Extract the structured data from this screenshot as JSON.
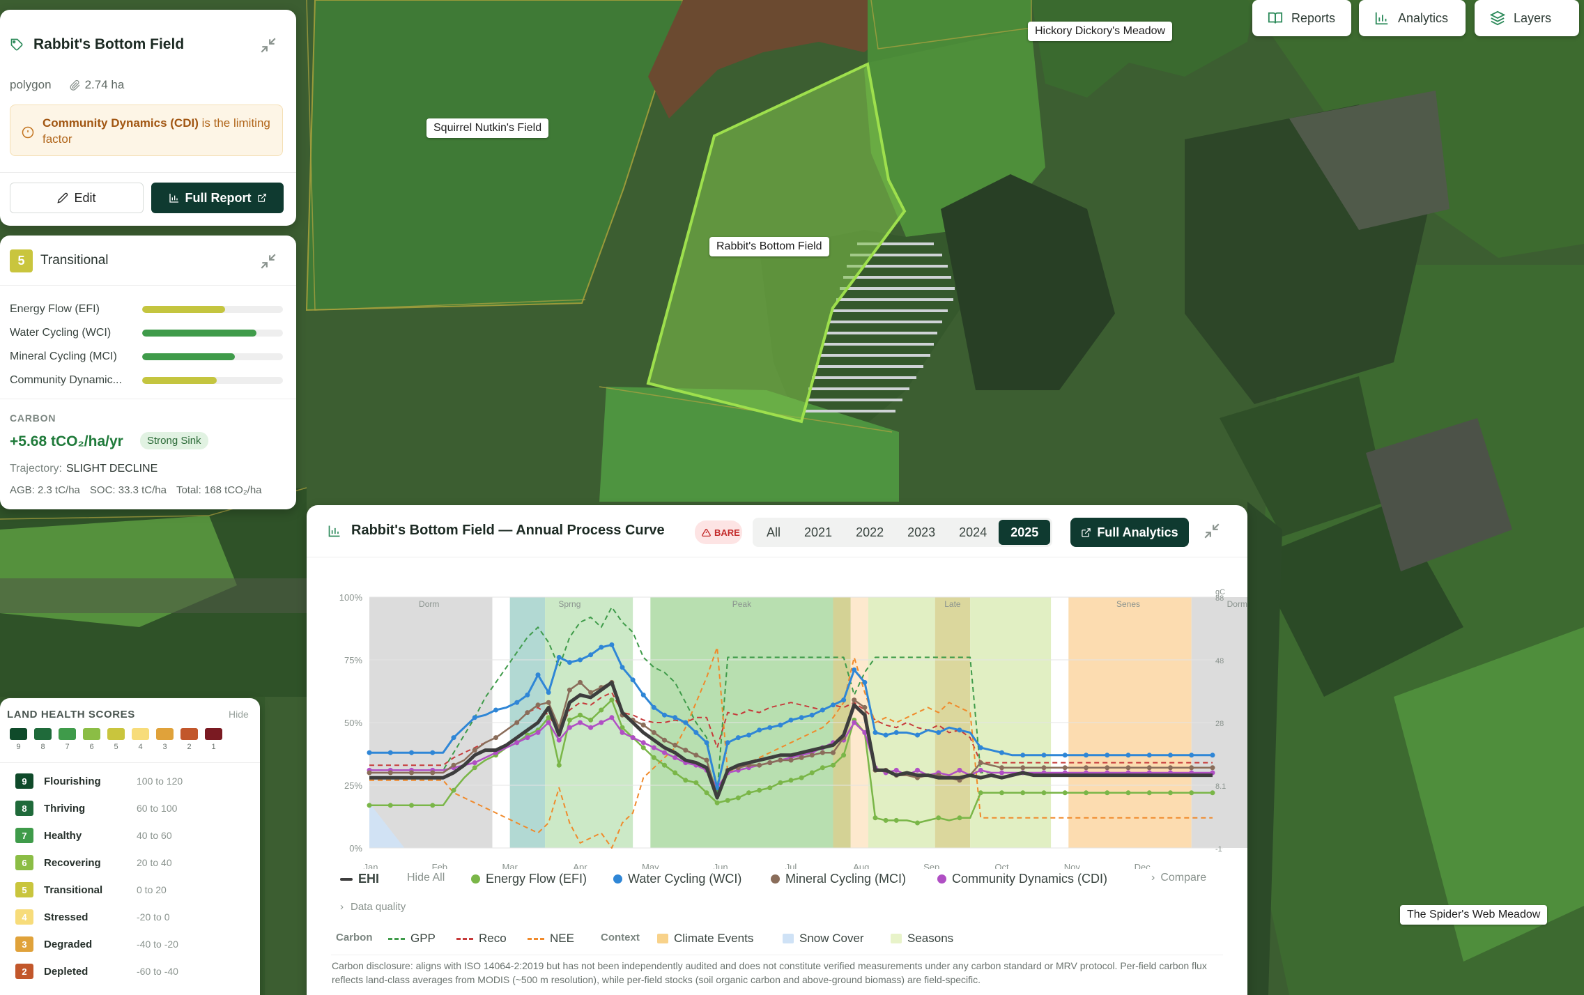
{
  "map": {
    "labels": {
      "squirrel": "Squirrel Nutkin's Field",
      "rabbit": "Rabbit's Bottom Field",
      "hickory": "Hickory Dickory's Meadow",
      "spider": "The Spider's Web Meadow"
    }
  },
  "toolbar": {
    "reports": "Reports",
    "analytics": "Analytics",
    "layers": "Layers"
  },
  "field_card": {
    "title": "Rabbit's Bottom Field",
    "geometry": "polygon",
    "area": "2.74 ha",
    "limiting_bold": "Community Dynamics (CDI)",
    "limiting_rest": " is the limiting factor",
    "edit_label": "Edit",
    "report_label": "Full Report"
  },
  "score_card": {
    "score": "5",
    "state": "Transitional",
    "state_color": "#c9c53d",
    "indices": [
      {
        "label": "Energy Flow (EFI)",
        "value": 0.59,
        "color": "#c4c53f"
      },
      {
        "label": "Water Cycling (WCI)",
        "value": 0.81,
        "color": "#3f9b4a"
      },
      {
        "label": "Mineral Cycling (MCI)",
        "value": 0.66,
        "color": "#3f9b4a"
      },
      {
        "label": "Community Dynamic...",
        "value": 0.53,
        "color": "#c4c53f"
      }
    ],
    "carbon_heading": "CARBON",
    "carbon_value": "+5.68 tCO₂/ha/yr",
    "sink_label": "Strong Sink",
    "trajectory_label": "Trajectory:",
    "trajectory_value": "SLIGHT DECLINE",
    "agb": "AGB: 2.3 tC/ha",
    "soc": "SOC: 33.3 tC/ha",
    "total": "Total: 168 tCO₂/ha"
  },
  "legend": {
    "title": "LAND HEALTH SCORES",
    "hide_label": "Hide",
    "swatches": [
      {
        "n": "9",
        "color": "#0f4a2a"
      },
      {
        "n": "8",
        "color": "#1f6a3a"
      },
      {
        "n": "7",
        "color": "#3f9b4a"
      },
      {
        "n": "6",
        "color": "#8bbd45"
      },
      {
        "n": "5",
        "color": "#c9c53d"
      },
      {
        "n": "4",
        "color": "#f7dc7a"
      },
      {
        "n": "3",
        "color": "#e0a23a"
      },
      {
        "n": "2",
        "color": "#c2572b"
      },
      {
        "n": "1",
        "color": "#7a1a22"
      }
    ],
    "rows": [
      {
        "n": "9",
        "name": "Flourishing",
        "range": "100 to 120",
        "color": "#0f4a2a"
      },
      {
        "n": "8",
        "name": "Thriving",
        "range": "60 to 100",
        "color": "#1f6a3a"
      },
      {
        "n": "7",
        "name": "Healthy",
        "range": "40 to 60",
        "color": "#3f9b4a"
      },
      {
        "n": "6",
        "name": "Recovering",
        "range": "20 to 40",
        "color": "#8bbd45"
      },
      {
        "n": "5",
        "name": "Transitional",
        "range": "0 to 20",
        "color": "#c9c53d"
      },
      {
        "n": "4",
        "name": "Stressed",
        "range": "-20 to 0",
        "color": "#f7dc7a"
      },
      {
        "n": "3",
        "name": "Degraded",
        "range": "-40 to -20",
        "color": "#e0a23a"
      },
      {
        "n": "2",
        "name": "Depleted",
        "range": "-60 to -40",
        "color": "#c2572b"
      }
    ]
  },
  "chart_panel": {
    "title": "Rabbit's Bottom Field — Annual Process Curve",
    "bare_badge": "BARE",
    "years": [
      "All",
      "2021",
      "2022",
      "2023",
      "2024",
      "2025"
    ],
    "active_year": "2025",
    "full_analytics": "Full Analytics",
    "legend": {
      "ehi": "EHI",
      "hide_all": "Hide All",
      "efi": "Energy Flow (EFI)",
      "wci": "Water Cycling (WCI)",
      "mci": "Mineral Cycling (MCI)",
      "cdi": "Community Dynamics (CDI)",
      "compare": "Compare"
    },
    "data_quality": "Data quality",
    "legend2": {
      "carbon_head": "Carbon",
      "gpp": "GPP",
      "reco": "Reco",
      "nee": "NEE",
      "context_head": "Context",
      "climate": "Climate Events",
      "snow": "Snow Cover",
      "seasons": "Seasons"
    },
    "disclaimer": "Carbon disclosure: aligns with ISO 14064-2:2019 but has not been independently audited and does not constitute verified measurements under any carbon standard or MRV protocol. Per-field carbon flux reflects land-class averages from MODIS (~500 m resolution), while per-field stocks (soil organic carbon and above-ground biomass) are field-specific."
  },
  "chart_data": {
    "type": "line",
    "x_months": [
      "Jan",
      "Feb",
      "Mar",
      "Apr",
      "May",
      "Jun",
      "Jul",
      "Aug",
      "Sep",
      "Oct",
      "Nov",
      "Dec"
    ],
    "ylim": [
      0,
      100
    ],
    "y_ticks": [
      "0%",
      "25%",
      "50%",
      "75%",
      "100%"
    ],
    "y2_ticks": [
      "88",
      "48",
      "28",
      "8.1",
      "-1"
    ],
    "y2_label": "gC",
    "season_labels": [
      "Dorm",
      "Sprng",
      "Peak",
      "Late",
      "Senes",
      "Dorm"
    ],
    "colors": {
      "ehi": "#3d3d3d",
      "efi": "#7ab648",
      "wci": "#2f86d6",
      "mci": "#8a6d5a",
      "cdi": "#b04fc4",
      "gpp": "#3f9b4a",
      "reco": "#c63a3a",
      "nee": "#f08a2b"
    },
    "x": [
      0.0,
      0.15,
      0.3,
      0.45,
      0.6,
      0.75,
      0.9,
      1.05,
      1.2,
      1.35,
      1.5,
      1.65,
      1.8,
      1.95,
      2.1,
      2.25,
      2.4,
      2.55,
      2.7,
      2.85,
      3.0,
      3.15,
      3.3,
      3.45,
      3.6,
      3.75,
      3.9,
      4.05,
      4.2,
      4.35,
      4.5,
      4.65,
      4.8,
      4.95,
      5.1,
      5.25,
      5.4,
      5.55,
      5.7,
      5.85,
      6.0,
      6.15,
      6.3,
      6.45,
      6.6,
      6.75,
      6.9,
      7.05,
      7.2,
      7.35,
      7.5,
      7.65,
      7.8,
      7.95,
      8.1,
      8.25,
      8.4,
      8.55,
      8.7,
      8.85,
      9.0,
      9.15,
      9.3,
      9.45,
      9.6,
      9.75,
      9.9,
      10.05,
      10.2,
      10.35,
      10.5,
      10.65,
      10.8,
      10.95,
      11.1,
      11.25,
      11.4,
      11.55,
      11.7,
      11.85,
      12.0
    ],
    "series": [
      {
        "name": "EHI",
        "values": [
          28,
          28,
          28,
          28,
          28,
          28,
          28,
          28,
          30,
          33,
          37,
          39,
          39,
          41,
          44,
          47,
          50,
          56,
          45,
          58,
          61,
          60,
          63,
          66,
          54,
          50,
          46,
          43,
          40,
          38,
          35,
          34,
          32,
          20,
          31,
          33,
          34,
          35,
          36,
          37,
          37,
          38,
          39,
          40,
          41,
          45,
          57,
          53,
          31,
          31,
          29,
          30,
          29,
          29,
          28,
          28,
          28,
          29,
          28,
          29,
          28,
          29,
          30,
          29,
          29,
          29,
          29,
          29,
          29,
          29,
          29,
          29,
          29,
          29,
          29,
          29,
          29,
          29,
          29,
          29,
          29
        ]
      },
      {
        "name": "Energy Flow (EFI)",
        "values": [
          17,
          17,
          17,
          17,
          17,
          17,
          17,
          17,
          23,
          28,
          32,
          35,
          37,
          40,
          42,
          45,
          47,
          52,
          33,
          51,
          53,
          51,
          55,
          59,
          48,
          44,
          40,
          36,
          33,
          30,
          27,
          26,
          22,
          18,
          19,
          20,
          22,
          23,
          24,
          26,
          27,
          28,
          30,
          32,
          33,
          37,
          51,
          46,
          12,
          11,
          11,
          11,
          10,
          11,
          12,
          11,
          12,
          12,
          22,
          22,
          22,
          22,
          22,
          22,
          22,
          22,
          22,
          22,
          22,
          22,
          22,
          22,
          22,
          22,
          22,
          22,
          22,
          22,
          22,
          22,
          22
        ]
      },
      {
        "name": "Water Cycling (WCI)",
        "values": [
          38,
          38,
          38,
          38,
          38,
          38,
          38,
          38,
          44,
          48,
          52,
          53,
          55,
          56,
          58,
          61,
          69,
          62,
          76,
          74,
          75,
          77,
          80,
          81,
          72,
          67,
          61,
          56,
          53,
          52,
          50,
          46,
          42,
          24,
          42,
          44,
          45,
          47,
          48,
          49,
          51,
          52,
          53,
          55,
          57,
          59,
          71,
          66,
          46,
          45,
          46,
          46,
          45,
          47,
          46,
          48,
          47,
          46,
          40,
          39,
          38,
          37,
          37,
          37,
          37,
          37,
          37,
          37,
          37,
          37,
          37,
          37,
          37,
          37,
          37,
          37,
          37,
          37,
          37,
          37,
          37
        ]
      },
      {
        "name": "Mineral Cycling (MCI)",
        "values": [
          30,
          30,
          30,
          30,
          30,
          30,
          30,
          30,
          33,
          35,
          39,
          42,
          44,
          47,
          50,
          54,
          57,
          58,
          48,
          63,
          66,
          62,
          64,
          66,
          53,
          51,
          49,
          46,
          43,
          41,
          39,
          37,
          35,
          21,
          31,
          32,
          33,
          33,
          34,
          35,
          35,
          36,
          37,
          38,
          38,
          44,
          59,
          56,
          31,
          31,
          29,
          29,
          28,
          29,
          29,
          28,
          27,
          29,
          34,
          33,
          32,
          32,
          32,
          32,
          32,
          32,
          32,
          32,
          32,
          32,
          32,
          32,
          32,
          32,
          32,
          32,
          32,
          32,
          32,
          32,
          32
        ]
      },
      {
        "name": "Community Dynamics (CDI)",
        "values": [
          31,
          31,
          31,
          31,
          31,
          31,
          31,
          31,
          32,
          33,
          34,
          36,
          38,
          40,
          42,
          44,
          46,
          50,
          43,
          48,
          50,
          48,
          50,
          52,
          46,
          44,
          42,
          40,
          38,
          36,
          34,
          33,
          31,
          24,
          30,
          31,
          32,
          33,
          34,
          35,
          36,
          37,
          38,
          40,
          42,
          43,
          50,
          46,
          32,
          30,
          31,
          29,
          31,
          29,
          30,
          29,
          31,
          29,
          31,
          30,
          30,
          30,
          30,
          30,
          30,
          30,
          30,
          30,
          30,
          30,
          30,
          30,
          30,
          30,
          30,
          30,
          30,
          30,
          30,
          30,
          30
        ]
      },
      {
        "name": "GPP",
        "values": [
          31,
          31,
          31,
          31,
          31,
          31,
          31,
          31,
          38,
          45,
          52,
          60,
          66,
          72,
          78,
          84,
          88,
          82,
          72,
          84,
          90,
          92,
          88,
          96,
          90,
          86,
          76,
          72,
          70,
          66,
          58,
          50,
          44,
          22,
          76,
          76,
          76,
          76,
          76,
          76,
          76,
          76,
          76,
          76,
          76,
          76,
          61,
          70,
          76,
          76,
          76,
          76,
          76,
          76,
          76,
          76,
          76,
          76,
          30,
          30,
          30,
          30,
          30,
          30,
          30,
          30,
          30,
          30,
          30,
          30,
          30,
          30,
          30,
          30,
          30,
          30,
          30,
          30,
          30,
          30,
          30
        ]
      },
      {
        "name": "Reco",
        "values": [
          33,
          33,
          33,
          33,
          33,
          33,
          33,
          33,
          36,
          38,
          40,
          42,
          44,
          47,
          50,
          54,
          56,
          53,
          46,
          55,
          58,
          57,
          60,
          62,
          54,
          53,
          51,
          50,
          50,
          51,
          50,
          52,
          52,
          40,
          54,
          53,
          55,
          54,
          56,
          57,
          58,
          57,
          56,
          55,
          57,
          56,
          58,
          55,
          51,
          49,
          48,
          50,
          48,
          47,
          49,
          46,
          47,
          44,
          34,
          34,
          34,
          34,
          34,
          34,
          34,
          34,
          34,
          34,
          34,
          34,
          34,
          34,
          34,
          34,
          34,
          34,
          34,
          34,
          34,
          34,
          34
        ]
      },
      {
        "name": "NEE",
        "values": [
          27,
          27,
          27,
          27,
          27,
          27,
          27,
          27,
          22,
          20,
          18,
          16,
          14,
          12,
          10,
          8,
          6,
          10,
          24,
          10,
          2,
          4,
          6,
          0,
          10,
          14,
          28,
          32,
          36,
          40,
          48,
          58,
          68,
          80,
          30,
          32,
          34,
          36,
          38,
          40,
          42,
          44,
          46,
          48,
          52,
          58,
          76,
          62,
          50,
          52,
          50,
          52,
          54,
          56,
          54,
          58,
          56,
          54,
          12,
          12,
          12,
          12,
          12,
          12,
          12,
          12,
          12,
          12,
          12,
          12,
          12,
          12,
          12,
          12,
          12,
          12,
          12,
          12,
          12,
          12,
          12
        ]
      }
    ]
  }
}
